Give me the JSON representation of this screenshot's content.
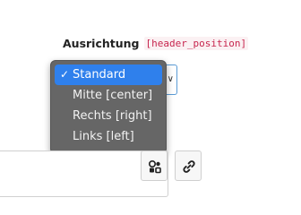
{
  "field": {
    "label": "Ausrichtung",
    "key": "[header_position]"
  },
  "select": {
    "selected": "Standard",
    "options": [
      {
        "label": "Standard",
        "selected": true
      },
      {
        "label": "Mitte [center]",
        "selected": false
      },
      {
        "label": "Rechts [right]",
        "selected": false
      },
      {
        "label": "Links [left]",
        "selected": false
      }
    ]
  },
  "toolbar": {
    "buttons": [
      {
        "icon": "gallery-icon"
      },
      {
        "icon": "link-icon"
      }
    ]
  },
  "colors": {
    "label_key_text": "#c7254e",
    "dropdown_bg": "#666666",
    "selected_option_bg": "#2f80ec",
    "field_border_focus": "#5b9bd5"
  }
}
